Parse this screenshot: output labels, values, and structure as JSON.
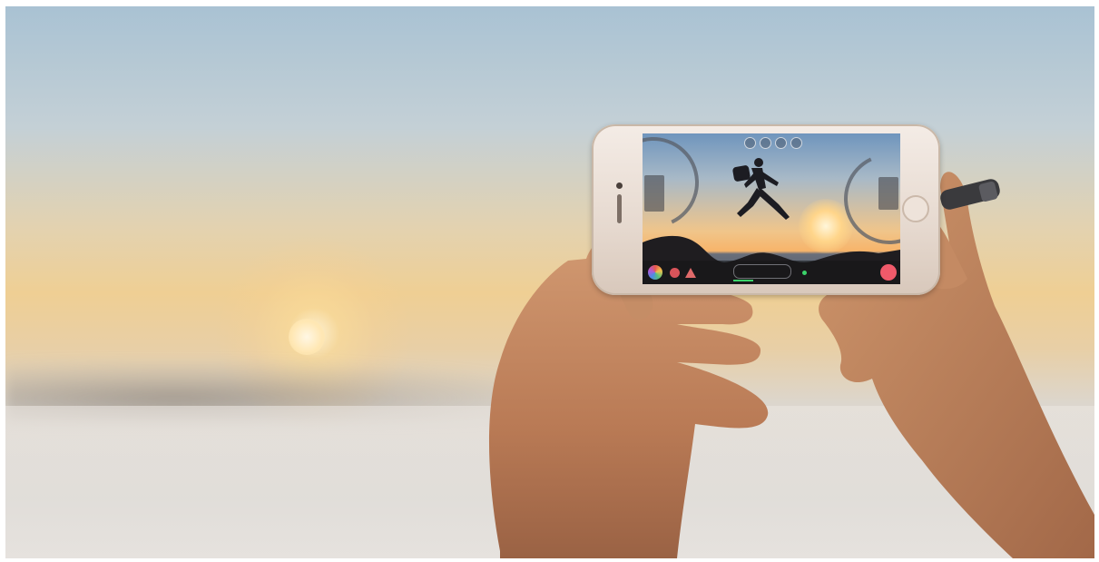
{
  "scene": {
    "description_colors": {
      "sky_top": "#a9c2d3",
      "horizon_glow": "#efcf94",
      "sea": "#ddd9d3",
      "skin": "#c98b66",
      "phone_body": "#e6d9cf",
      "record_button": "#ef5a6a",
      "level_indicator": "#3bd36a"
    }
  },
  "phone_screen": {
    "icons": [
      "settings-icon",
      "exposure-icon",
      "focus-icon",
      "white-balance-icon"
    ],
    "bottom_bar_icons": [
      "color-wheel-icon",
      "filter-icon",
      "mountain-icon",
      "timecode-display",
      "audio-level-icon",
      "record-button"
    ]
  }
}
